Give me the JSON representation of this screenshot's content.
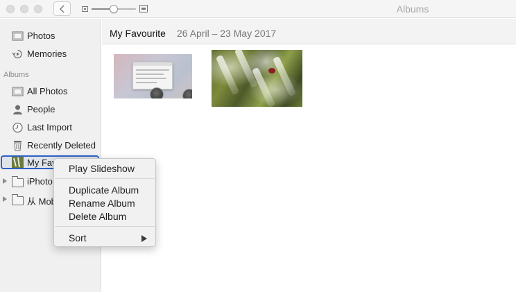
{
  "window": {
    "title": "Albums"
  },
  "sidebar": {
    "library_items": [
      {
        "label": "Photos"
      },
      {
        "label": "Memories"
      }
    ],
    "albums_header": "Albums",
    "album_items": [
      {
        "label": "All Photos"
      },
      {
        "label": "People"
      },
      {
        "label": "Last Import"
      },
      {
        "label": "Recently Deleted"
      },
      {
        "label": "My Favourite"
      },
      {
        "label": "iPhoto"
      },
      {
        "label": "从 Mobile"
      }
    ]
  },
  "main": {
    "album_title": "My Favourite",
    "date_range": "26 April – 23 May 2017"
  },
  "context_menu": {
    "items": [
      {
        "label": "Play Slideshow"
      },
      {
        "label": "Duplicate Album"
      },
      {
        "label": "Rename Album"
      },
      {
        "label": "Delete Album"
      },
      {
        "label": "Sort"
      }
    ]
  },
  "zoom_slider": {
    "level": 0.5
  },
  "colors": {
    "selection_border": "#2e61c6",
    "sidebar_bg": "#f0f0f0"
  }
}
